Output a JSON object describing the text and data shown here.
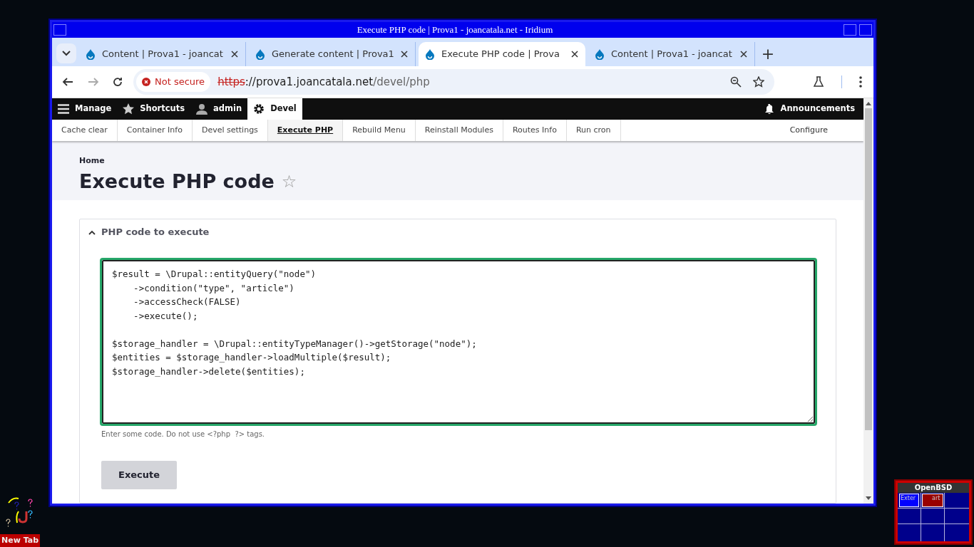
{
  "window": {
    "title": "Execute PHP code | Prova1 - joancatala.net - Iridium"
  },
  "browser": {
    "tabs": [
      {
        "label": "Content | Prova1 - joancat",
        "selected": false
      },
      {
        "label": "Generate content | Prova1",
        "selected": false
      },
      {
        "label": "Execute PHP code | Prova",
        "selected": true
      },
      {
        "label": "Content | Prova1 - joancat",
        "selected": false
      }
    ],
    "new_tab": "+",
    "address": {
      "security": "Not secure",
      "scheme": "https",
      "rest": "://prova1.joancatala.net",
      "path": "/devel/php"
    }
  },
  "toolbar": {
    "items": [
      {
        "label": "Manage",
        "selected": false
      },
      {
        "label": "Shortcuts",
        "selected": false
      },
      {
        "label": "admin",
        "selected": false
      },
      {
        "label": "Devel",
        "selected": true
      }
    ],
    "announcements": "Announcements"
  },
  "devel_tabs": [
    {
      "label": "Cache clear",
      "selected": false
    },
    {
      "label": "Container Info",
      "selected": false
    },
    {
      "label": "Devel settings",
      "selected": false
    },
    {
      "label": "Execute PHP",
      "selected": true
    },
    {
      "label": "Rebuild Menu",
      "selected": false
    },
    {
      "label": "Reinstall Modules",
      "selected": false
    },
    {
      "label": "Routes Info",
      "selected": false
    },
    {
      "label": "Run cron",
      "selected": false
    }
  ],
  "configure": "Configure",
  "breadcrumb": "Home",
  "page_title": "Execute PHP code",
  "favorite": "☆",
  "details": {
    "summary": "PHP code to execute",
    "expanded": true,
    "code": [
      "$result = \\Drupal::entityQuery(\"node\")",
      "    ->condition(\"type\", \"article\")",
      "    ->accessCheck(FALSE)",
      "    ->execute();\n",
      "$storage_handler = \\Drupal::entityTypeManager()->getStorage(\"node\");",
      "$entities = $storage_handler->loadMultiple($result);",
      "$storage_handler->delete($entities);"
    ],
    "description": "Enter some code. Do not use <?php  ?> tags.",
    "button": "Execute"
  },
  "desktop": {
    "new_tab": "New Tab",
    "pager": {
      "title": "OpenBSD",
      "windows": [
        "Exter",
        "art"
      ]
    }
  }
}
